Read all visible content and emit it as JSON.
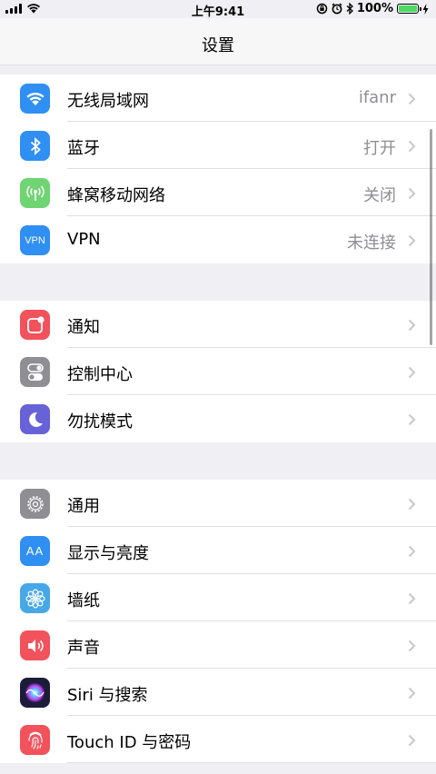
{
  "status_bar": {
    "time": "上午9:41",
    "battery_percent": "100%",
    "battery_level": 1.0,
    "colors": {
      "battery_fill": "#4cd964"
    }
  },
  "nav": {
    "title": "设置"
  },
  "groups": [
    {
      "rows": [
        {
          "name": "wifi",
          "label": "无线局域网",
          "value": "ifanr",
          "icon": "wifi-icon",
          "color": "#2f8ff2"
        },
        {
          "name": "bluetooth",
          "label": "蓝牙",
          "value": "打开",
          "icon": "bluetooth-icon",
          "color": "#2f8ff2"
        },
        {
          "name": "cellular",
          "label": "蜂窝移动网络",
          "value": "关闭",
          "icon": "cellular-antenna-icon",
          "color": "#6fd472"
        },
        {
          "name": "vpn",
          "label": "VPN",
          "value": "未连接",
          "icon": "vpn-icon",
          "icon_text": "VPN",
          "color": "#2f8ff2"
        }
      ]
    },
    {
      "rows": [
        {
          "name": "notifications",
          "label": "通知",
          "value": "",
          "icon": "notifications-icon",
          "color": "#f2525c"
        },
        {
          "name": "control-center",
          "label": "控制中心",
          "value": "",
          "icon": "switches-icon",
          "color": "#8e8e93"
        },
        {
          "name": "do-not-disturb",
          "label": "勿扰模式",
          "value": "",
          "icon": "moon-icon",
          "color": "#6762d8"
        }
      ]
    },
    {
      "rows": [
        {
          "name": "general",
          "label": "通用",
          "value": "",
          "icon": "gear-icon",
          "color": "#8e8e93"
        },
        {
          "name": "display",
          "label": "显示与亮度",
          "value": "",
          "icon": "text-size-icon",
          "icon_text": "AA",
          "color": "#2f8ff2"
        },
        {
          "name": "wallpaper",
          "label": "墙纸",
          "value": "",
          "icon": "flower-icon",
          "color": "#47a8e8"
        },
        {
          "name": "sounds",
          "label": "声音",
          "value": "",
          "icon": "speaker-icon",
          "color": "#f2525c"
        },
        {
          "name": "siri",
          "label": "Siri 与搜索",
          "value": "",
          "icon": "siri-icon",
          "color": "#1c1c3a"
        },
        {
          "name": "touch-id",
          "label": "Touch ID 与密码",
          "value": "",
          "icon": "fingerprint-icon",
          "color": "#f2525c"
        }
      ]
    }
  ]
}
